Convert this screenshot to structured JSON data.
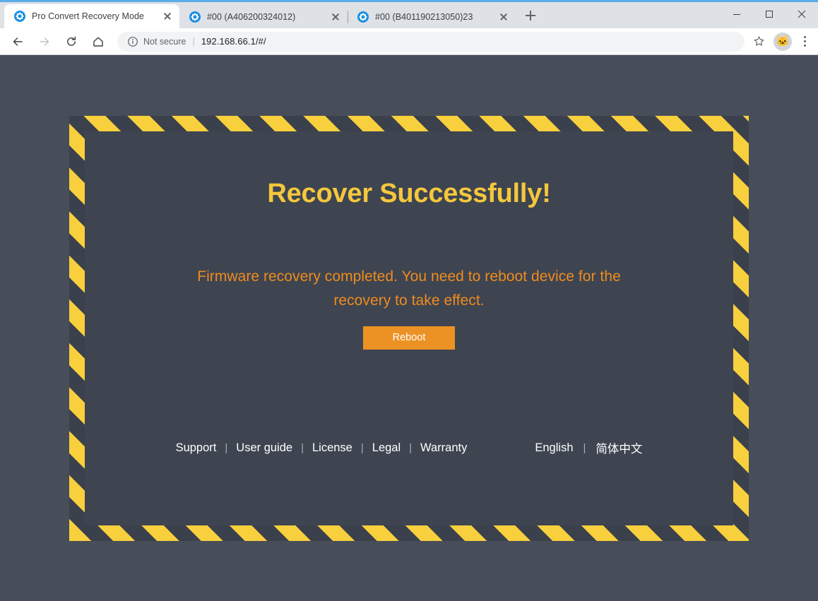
{
  "window": {
    "minimize_label": "Minimize",
    "maximize_label": "Maximize",
    "close_label": "Close"
  },
  "tabs": [
    {
      "title": "Pro Convert Recovery Mode",
      "active": true,
      "favicon": "gear-icon"
    },
    {
      "title": "#00 (A406200324012)",
      "active": false,
      "favicon": "gear-icon"
    },
    {
      "title": "#00 (B401190213050)23",
      "active": false,
      "favicon": "gear-icon"
    }
  ],
  "newtab_label": "New tab",
  "toolbar": {
    "back_label": "Back",
    "forward_label": "Forward",
    "reload_label": "Reload",
    "home_label": "Home",
    "security_text": "Not secure",
    "separator": "|",
    "url": "192.168.66.1/#/",
    "bookmark_label": "Bookmark this page",
    "avatar_glyph": "🐱",
    "menu_label": "Customize and control"
  },
  "page": {
    "headline": "Recover Successfully!",
    "message": "Firmware recovery completed. You need to reboot device for the recovery to take effect.",
    "reboot_label": "Reboot",
    "footer_links": [
      {
        "label": "Support"
      },
      {
        "label": "User guide"
      },
      {
        "label": "License"
      },
      {
        "label": "Legal"
      },
      {
        "label": "Warranty"
      }
    ],
    "link_separator": "|",
    "languages": [
      {
        "label": "English"
      },
      {
        "label": "简体中文"
      }
    ],
    "lang_separator": "|"
  },
  "colors": {
    "page_background": "#474e59",
    "panel_background": "#3e4551",
    "hazard_yellow": "#f8cf3d",
    "hazard_dark": "#3b414c",
    "headline_yellow": "#f5c73c",
    "message_orange": "#f08b1d",
    "button_orange": "#ec9224",
    "tab_active_bg": "#ffffff",
    "titlebar_bg": "#dee1e6",
    "accent_blue": "#5aaee8"
  }
}
